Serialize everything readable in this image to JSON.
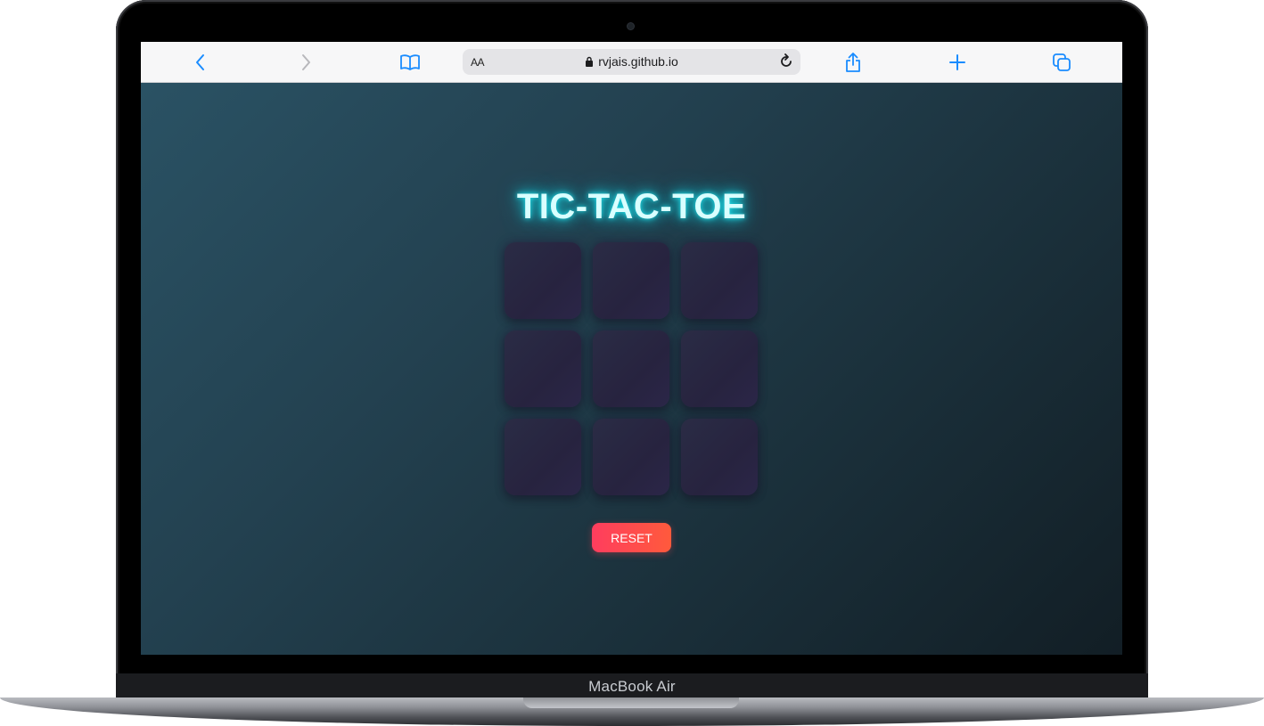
{
  "device": {
    "brand_label": "MacBook Air"
  },
  "browser": {
    "text_size_label": "AA",
    "url": "rvjais.github.io",
    "icons": {
      "back": "chevron-left-icon",
      "forward": "chevron-right-icon",
      "bookmarks": "book-icon",
      "lock": "lock-icon",
      "reload": "reload-icon",
      "share": "share-icon",
      "new_tab": "plus-icon",
      "tabs": "tabs-icon"
    },
    "accent_color": "#1a8cff"
  },
  "game": {
    "title": "TIC-TAC-TOE",
    "cells": [
      "",
      "",
      "",
      "",
      "",
      "",
      "",
      "",
      ""
    ],
    "reset_label": "RESET",
    "colors": {
      "title_glow": "#17c8d6",
      "cell": "#282540",
      "reset_start": "#ff3d5e",
      "reset_end": "#ff5a3c"
    }
  }
}
